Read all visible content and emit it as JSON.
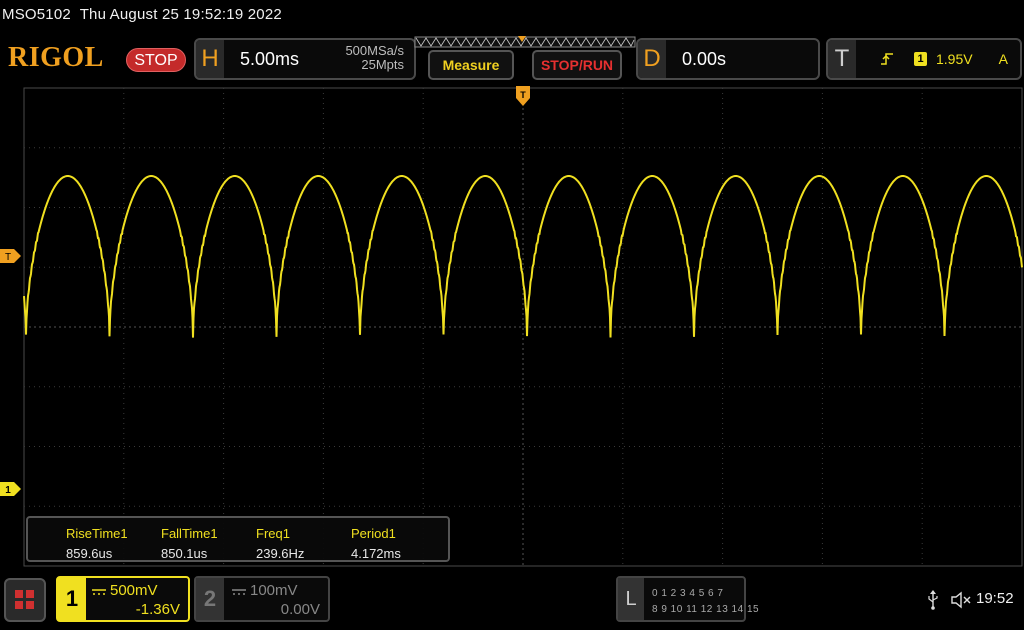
{
  "statusline": {
    "model": "MSO5102",
    "datetime": "Thu August 25 19:52:19 2022"
  },
  "brand": "RIGOL",
  "run_state": "STOP",
  "horizontal": {
    "letter": "H",
    "timebase": "5.00ms",
    "sample_rate": "500MSa/s",
    "memory_depth": "25Mpts"
  },
  "buttons": {
    "measure": "Measure",
    "stop_run": "STOP/RUN"
  },
  "delay": {
    "letter": "D",
    "value": "0.00s"
  },
  "trigger": {
    "letter": "T",
    "channel": "1",
    "level": "1.95V",
    "mode": "A",
    "left_marker": "T",
    "edge": "rising-edge-icon"
  },
  "measurements": [
    {
      "name": "RiseTime1",
      "value": "859.6us"
    },
    {
      "name": "FallTime1",
      "value": "850.1us"
    },
    {
      "name": "Freq1",
      "value": "239.6Hz"
    },
    {
      "name": "Period1",
      "value": "4.172ms"
    }
  ],
  "channels": [
    {
      "num": "1",
      "scale": "500mV",
      "offset": "-1.36V",
      "active": true,
      "color": "#f0e020"
    },
    {
      "num": "2",
      "scale": "100mV",
      "offset": "0.00V",
      "active": false,
      "color": "#888888"
    }
  ],
  "logic": {
    "letter": "L",
    "row1": "0 1 2 3   4 5 6 7",
    "row2": "8  9 10 11  12 13 14 15"
  },
  "clock": "19:52",
  "colors": {
    "trace": "#f0e020",
    "brand": "#f0a020",
    "stop": "#c42a2a",
    "grid": "#3a3a3a"
  }
}
